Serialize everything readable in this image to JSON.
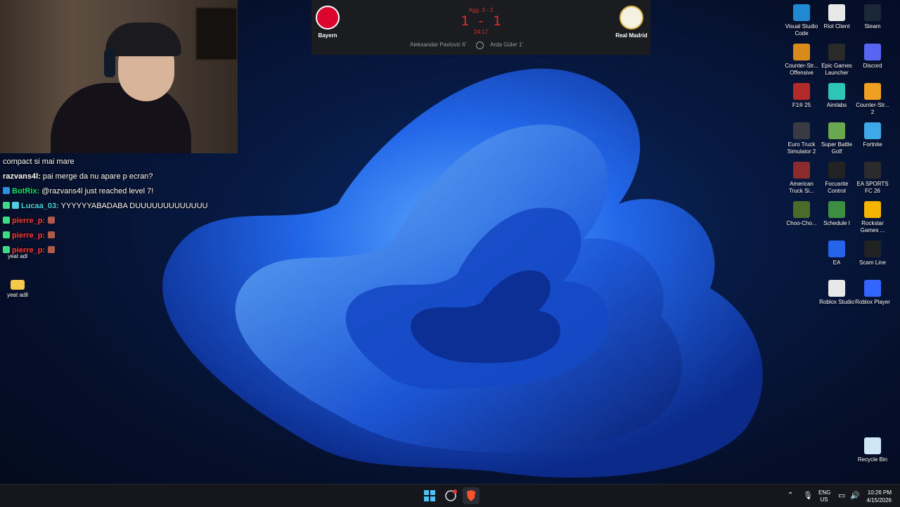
{
  "scoreboard": {
    "home": "Bayern",
    "away": "Real Madrid",
    "aggregate": "Agg. 3 - 2",
    "score": "1 - 1",
    "clock": "24:17",
    "home_scorer": "Aleksandar Pavlović 6'",
    "away_scorer": "Arda Güler 1'"
  },
  "chat": {
    "messages": [
      {
        "name": "",
        "text": "compact si mai mare",
        "color": "#ffffff"
      },
      {
        "name": "razvans4l:",
        "text": " pai merge da nu apare p ecran?",
        "color": "#ffffff"
      },
      {
        "name": "BotRix:",
        "text": " @razvans4l just reached level 7!",
        "color": "#00e676"
      },
      {
        "name": "Lucaa_03:",
        "text": " YYYYYYABADABA DUUUUUUUUUUUUU",
        "color": "#4dd0e1"
      },
      {
        "name": "pierre_p:",
        "text": "",
        "color": "#ff3b3b"
      },
      {
        "name": "pierre_p:",
        "text": "",
        "color": "#ff3b3b"
      },
      {
        "name": "pierre_p:",
        "text": "",
        "color": "#ff3b3b"
      }
    ]
  },
  "desktop_left": {
    "icon1": "yeat adl",
    "icon2": "yeat adll"
  },
  "desktop_icons": [
    {
      "label": "Visual Studio Code",
      "icon": "vscode-icon",
      "color": "#1f8ad2"
    },
    {
      "label": "Riot Client",
      "icon": "file-icon",
      "color": "#e8e8e8"
    },
    {
      "label": "Steam",
      "icon": "steam-icon",
      "color": "#1b2838"
    },
    {
      "label": "Counter-Str... Offensive",
      "icon": "csgo-icon",
      "color": "#d88a1a"
    },
    {
      "label": "Epic Games Launcher",
      "icon": "epic-icon",
      "color": "#2a2a2a"
    },
    {
      "label": "Discord",
      "icon": "discord-icon",
      "color": "#5865f2"
    },
    {
      "label": "F1® 25",
      "icon": "f1-icon",
      "color": "#b22a2a"
    },
    {
      "label": "Aimlabs",
      "icon": "aimlabs-icon",
      "color": "#2ec4b6"
    },
    {
      "label": "Counter-Str... 2",
      "icon": "cs2-icon",
      "color": "#f0a020"
    },
    {
      "label": "Euro Truck Simulator 2",
      "icon": "truck-icon",
      "color": "#3a3a44"
    },
    {
      "label": "Super Battle Golf",
      "icon": "golf-icon",
      "color": "#6aa84f"
    },
    {
      "label": "Fortnite",
      "icon": "fortnite-icon",
      "color": "#3fa8e6"
    },
    {
      "label": "American Truck Si...",
      "icon": "truck-icon",
      "color": "#8c2b2b"
    },
    {
      "label": "Focusrite Control",
      "icon": "focusrite-icon",
      "color": "#222222"
    },
    {
      "label": "EA SPORTS FC 26",
      "icon": "fc-icon",
      "color": "#2b2b2b"
    },
    {
      "label": "Choo-Cho...",
      "icon": "choo-icon",
      "color": "#4b6b2a"
    },
    {
      "label": "Schedule I",
      "icon": "schedule-icon",
      "color": "#3e8e41"
    },
    {
      "label": "Rockstar Games ...",
      "icon": "rockstar-icon",
      "color": "#f4b400"
    },
    {
      "label": "EA",
      "icon": "ea-icon",
      "color": "#2563eb"
    },
    {
      "label": "Scam Line",
      "icon": "scamline-icon",
      "color": "#222222"
    },
    {
      "label": "Roblox Studio",
      "icon": "roblox-studio-icon",
      "color": "#e8e8e8"
    },
    {
      "label": "Roblox Player",
      "icon": "roblox-icon",
      "color": "#3366ff"
    },
    {
      "label": "Recycle Bin",
      "icon": "recycle-bin-icon",
      "color": "#cfe6f7"
    }
  ],
  "tray": {
    "lang_top": "ENG",
    "lang_bottom": "US",
    "time": "10:26 PM",
    "date": "4/15/2026"
  }
}
